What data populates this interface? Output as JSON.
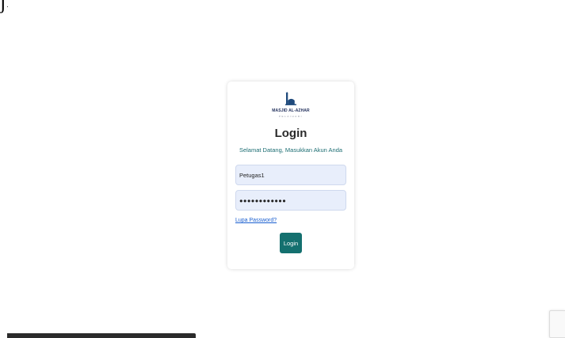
{
  "page": {
    "corner_fragment": "j"
  },
  "login_card": {
    "logo": {
      "icon": "mosque-minaret-icon",
      "title": "MASJID AL-AZHAR",
      "subtitle": "PELAIHARI"
    },
    "title": "Login",
    "subtitle": "Selamat Datang, Masukkan Akun Anda",
    "username": {
      "value": "Petugas1"
    },
    "password": {
      "value": "●●●●●●●●●●●●"
    },
    "forgot_password_label": "Lupa Password?",
    "login_button_label": "Login"
  },
  "colors": {
    "accent": "#14706f",
    "subtitle_text": "#1d6e73",
    "input_background": "#e8eefb",
    "link": "#1a5fd0",
    "logo_text": "#1f2d5a"
  },
  "overlays": {
    "status_bar": {
      "present": true
    },
    "recaptcha_badge": {
      "present": true
    }
  }
}
